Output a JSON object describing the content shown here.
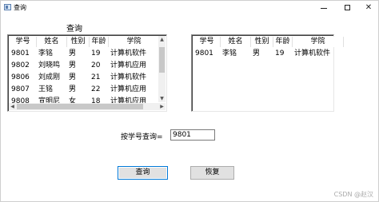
{
  "window": {
    "title": "查询",
    "minimize": "—",
    "maximize": "□",
    "close": "✕"
  },
  "label_top": "查询",
  "columns": [
    "学号",
    "姓名",
    "性别",
    "年龄",
    "学院"
  ],
  "left_list": {
    "rows": [
      [
        "9801",
        "李铭",
        "男",
        "19",
        "计算机软件"
      ],
      [
        "9802",
        "刘晓鸣",
        "男",
        "20",
        "计算机应用"
      ],
      [
        "9806",
        "刘成刚",
        "男",
        "21",
        "计算机软件"
      ],
      [
        "9807",
        "王铭",
        "男",
        "22",
        "计算机应用"
      ],
      [
        "9808",
        "宣明尼",
        "女",
        "18",
        "计算机应用"
      ]
    ]
  },
  "right_list": {
    "rows": [
      [
        "9801",
        "李铭",
        "男",
        "19",
        "计算机软件"
      ]
    ]
  },
  "query": {
    "label": "按学号查询=",
    "value": "9801"
  },
  "buttons": {
    "query": "查询",
    "restore": "恢复"
  },
  "watermark": "CSDN @赵汉"
}
